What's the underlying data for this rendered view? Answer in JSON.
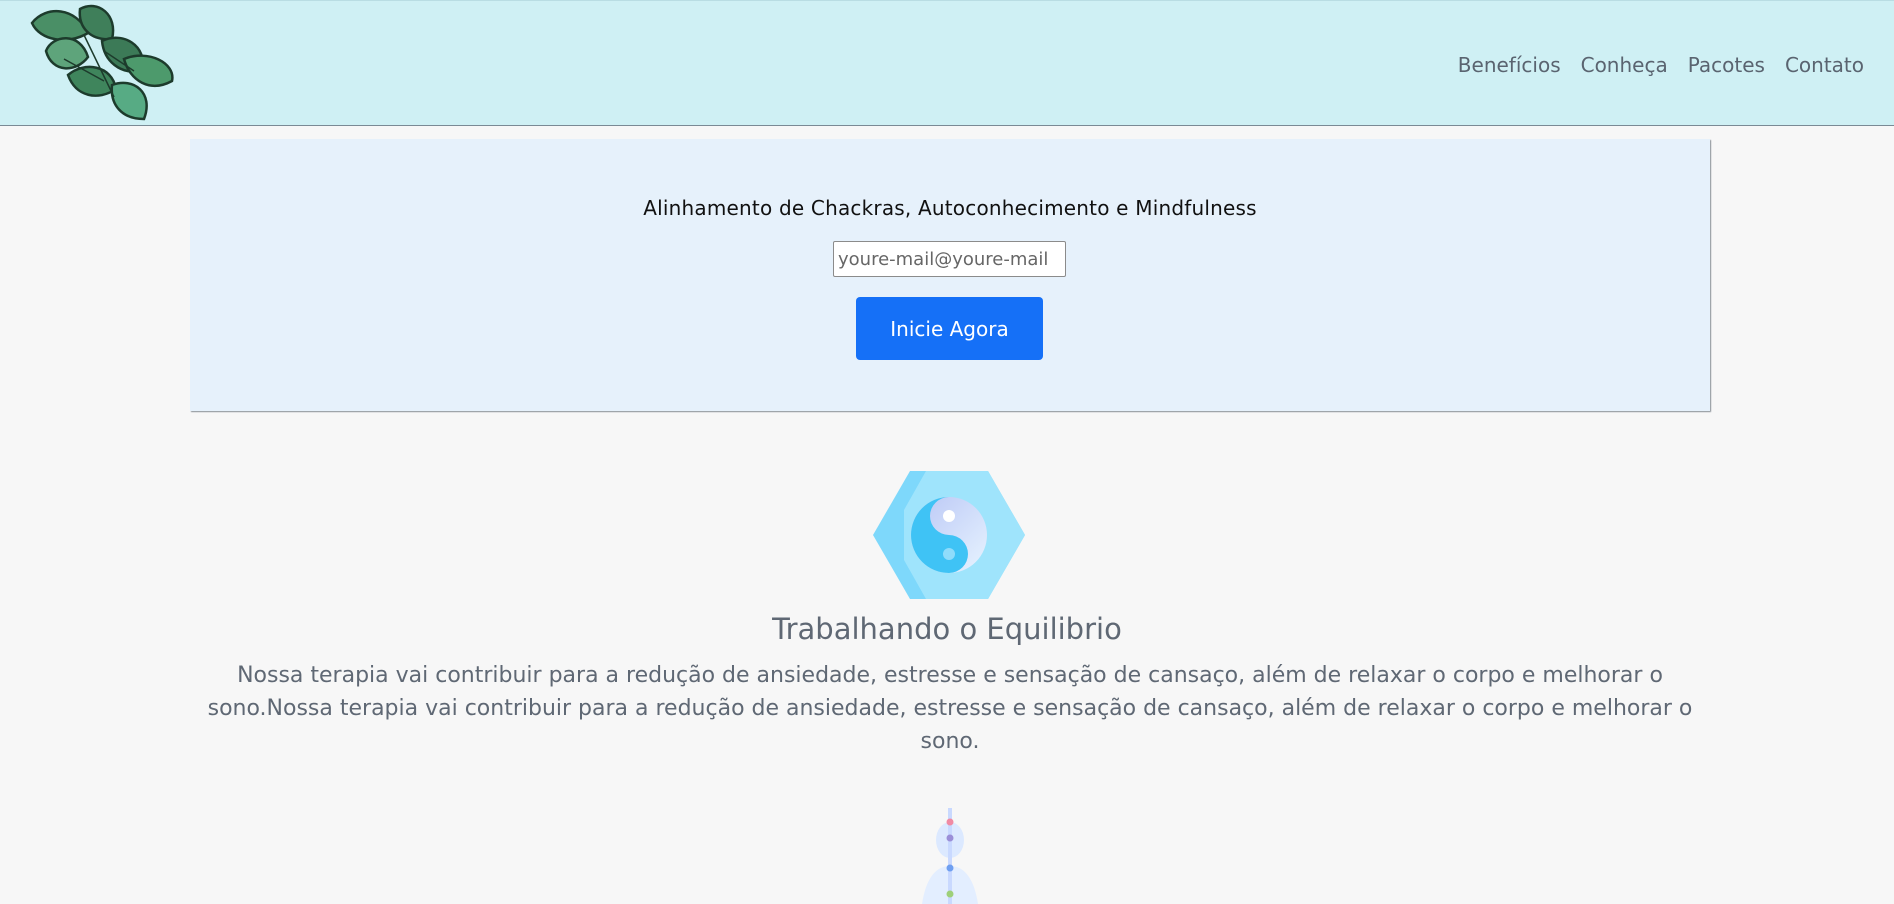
{
  "header": {
    "logo_icon": "mint-leaves-logo",
    "nav": [
      {
        "label": "Benefícios"
      },
      {
        "label": "Conheça"
      },
      {
        "label": "Pacotes"
      },
      {
        "label": "Contato"
      }
    ]
  },
  "hero": {
    "subtitle": "Alinhamento de Chackras, Autoconhecimento e Mindfulness",
    "email_placeholder": "youre-mail@youre-mail",
    "email_value": "",
    "cta_label": "Inicie Agora"
  },
  "feature": {
    "icon": "yin-yang-icon",
    "title": "Trabalhando o Equilibrio",
    "text": "Nossa terapia vai contribuir para a redução de ansiedade, estresse e sensação de cansaço, além de relaxar o corpo e melhorar o sono.Nossa terapia vai contribuir para a redução de ansiedade, estresse e sensação de cansaço, além de relaxar o corpo e melhorar o sono."
  },
  "next_section": {
    "icon": "chakra-body-icon"
  },
  "colors": {
    "header_bg": "#cff0f4",
    "hero_bg": "#e6f1fb",
    "accent": "#1570f7",
    "text_muted": "#5f6874"
  }
}
